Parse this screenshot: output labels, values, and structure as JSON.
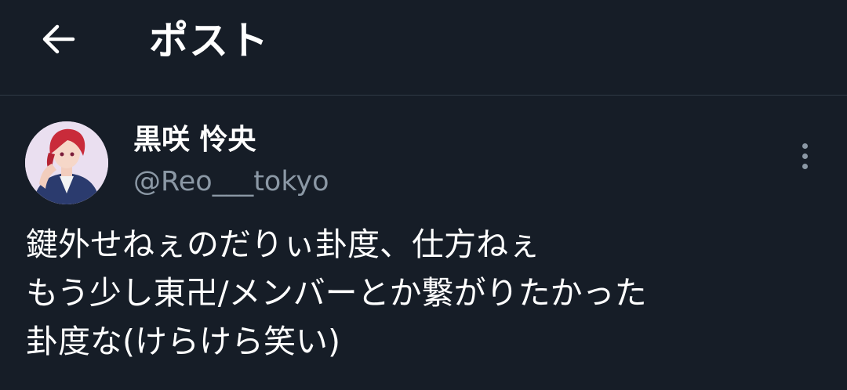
{
  "header": {
    "title": "ポスト",
    "back_icon": "arrow-left-icon"
  },
  "post": {
    "author": {
      "display_name": "黒咲 怜央",
      "handle": "@Reo___tokyo"
    },
    "more_icon": "vertical-ellipsis-icon",
    "text": "鍵外せねぇのだりぃ卦度、仕方ねぇ\nもう少し東卍/メンバーとか繋がりたかった\n卦度な(けらけら笑い)"
  },
  "colors": {
    "background": "#161d27",
    "divider": "#2f3a45",
    "primary_text": "#ffffff",
    "secondary_text": "#8b98a5"
  }
}
